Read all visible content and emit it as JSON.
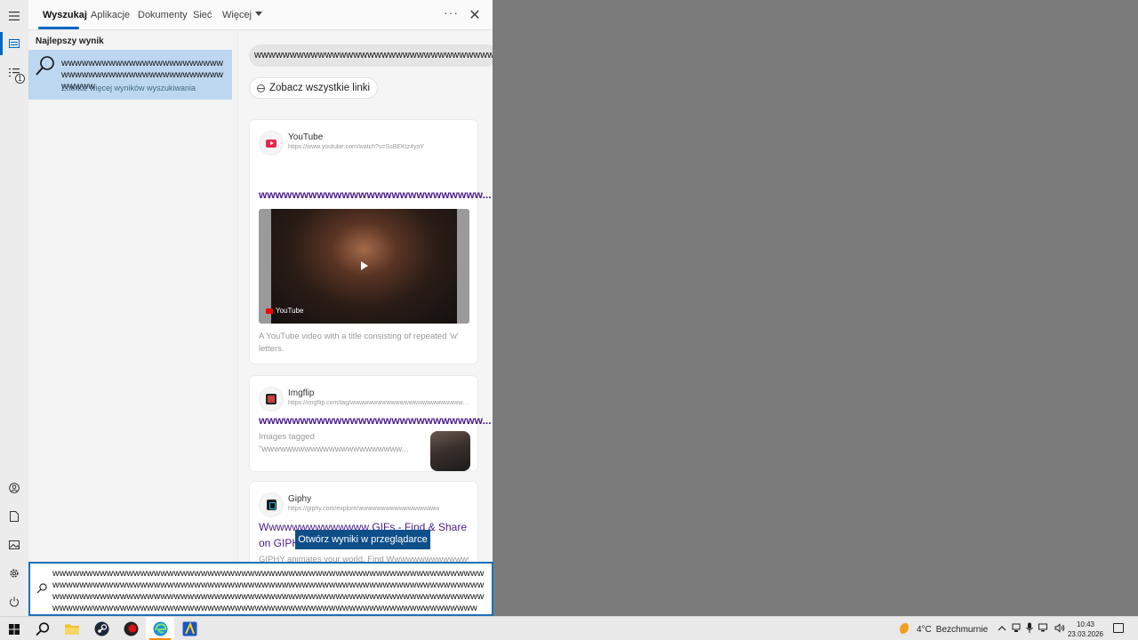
{
  "tabs": [
    {
      "label": "Wyszukaj"
    },
    {
      "label": "Aplikacje"
    },
    {
      "label": "Dokumenty"
    },
    {
      "label": "Sieć"
    },
    {
      "label": "Więcej"
    }
  ],
  "left": {
    "best_label": "Najlepszy wynik",
    "best_title": "wwwwwwwwwwwwwwwwwwwwwwwwwwwwwwwwwwwwwwwwwwwwwwwwwwwww",
    "best_sub": "Zobacz więcej wyników wyszukiwania"
  },
  "right": {
    "query": "wwwwwwwwwwwwwwwwwwwwwwwwwwwwwwwwwwwwwwwwwwwwwwwwwwwwwwwwwwwwww",
    "see_links": "Zobacz wszystkie linki",
    "results": [
      {
        "source": "YouTube",
        "url": "https://www.youtube.com/watch?v=SsBEKtz4yoY",
        "title": "wwwwwwwwwwwwwwwwwwwwwwwwwww...",
        "video_badge": "YouTube",
        "desc": "A YouTube video with a title consisting of repeated 'w' letters."
      },
      {
        "source": "Imgflip",
        "url": "https://imgflip.com/tag/wwwwwwwwwwwwwwwwwwwwwwwwwwwwwwwww...",
        "title": "wwwwwwwwwwwwwwwwwwwwwwwwwww...",
        "desc": "Images tagged \"wwwwwwwwwwwwwwwwwwwwwww..."
      },
      {
        "source": "Giphy",
        "url": "https://giphy.com/explore/wwwwwwwwwwwwwwwwww",
        "title": "Wwwwwwwwwwwwww GIFs - Find & Share on GIPHY",
        "desc": "GIPHY animates your world. Find Wwwwwwwwwwwwww"
      }
    ]
  },
  "tooltip": "Otwórz wyniki w przeglądarce",
  "searchbox": {
    "text": "wwwwwwwwwwwwwwwwwwwwwwwwwwwwwwwwwwwwwwwwwwwwwwwwwwwwwwwwwwwwwwwwwwwwwwwwwwwwwwwwwwwwwwwwwwwwwwwwwwwwwwwwwwwwwwwwwwwwwwwwwwwwwwwwwwwwwwwwwwwwwwwwwwwwwwwwwwwwwwwwwwwwwwwwwwwwwwwwwwwwwwwwwwwwwwwwwwwwwwwwwwwwwwwwwwwwwwwwwwwwwwwwwwwwwwwwwwwwwwwwwwwwwwwwwwwwwww"
  },
  "rail": {
    "badge": "1"
  },
  "taskbar": {
    "weather_temp": "4°C",
    "weather_desc": "Bezchmurnie",
    "time": "10:43",
    "date": "23.03.2026"
  },
  "colors": {
    "accent": "#0067c0",
    "selected": "#bcd7ef",
    "link": "#4b1a8a",
    "tooltip": "#0f4f89"
  }
}
